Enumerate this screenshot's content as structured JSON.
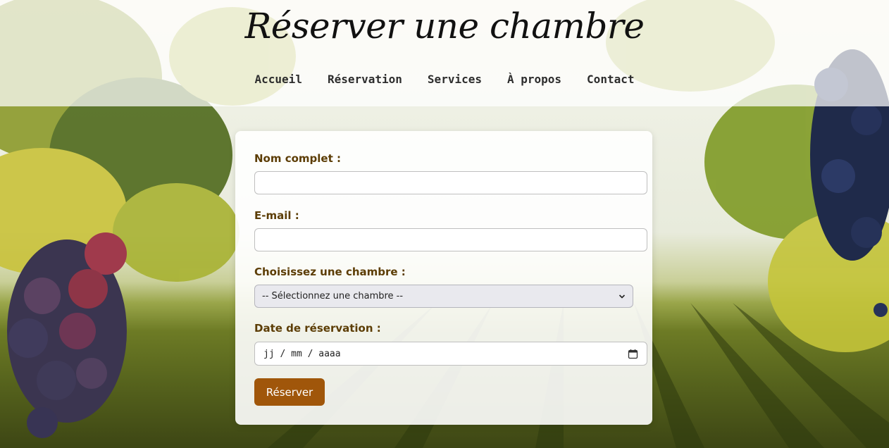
{
  "header": {
    "title": "Réserver une chambre",
    "nav": [
      "Accueil",
      "Réservation",
      "Services",
      "À propos",
      "Contact"
    ]
  },
  "form": {
    "name_label": "Nom complet :",
    "name_value": "",
    "email_label": "E-mail :",
    "email_value": "",
    "room_label": "Choisissez une chambre :",
    "room_selected": "-- Sélectionnez une chambre --",
    "date_label": "Date de réservation :",
    "date_placeholder": "jj / mm / aaaa",
    "submit_label": "Réserver"
  },
  "icons": {
    "select_arrow": "chevron-down-icon",
    "date_picker": "calendar-icon"
  },
  "colors": {
    "label": "#5c3d05",
    "button": "#a0560a",
    "header_overlay": "rgba(255,255,255,0.72)"
  }
}
